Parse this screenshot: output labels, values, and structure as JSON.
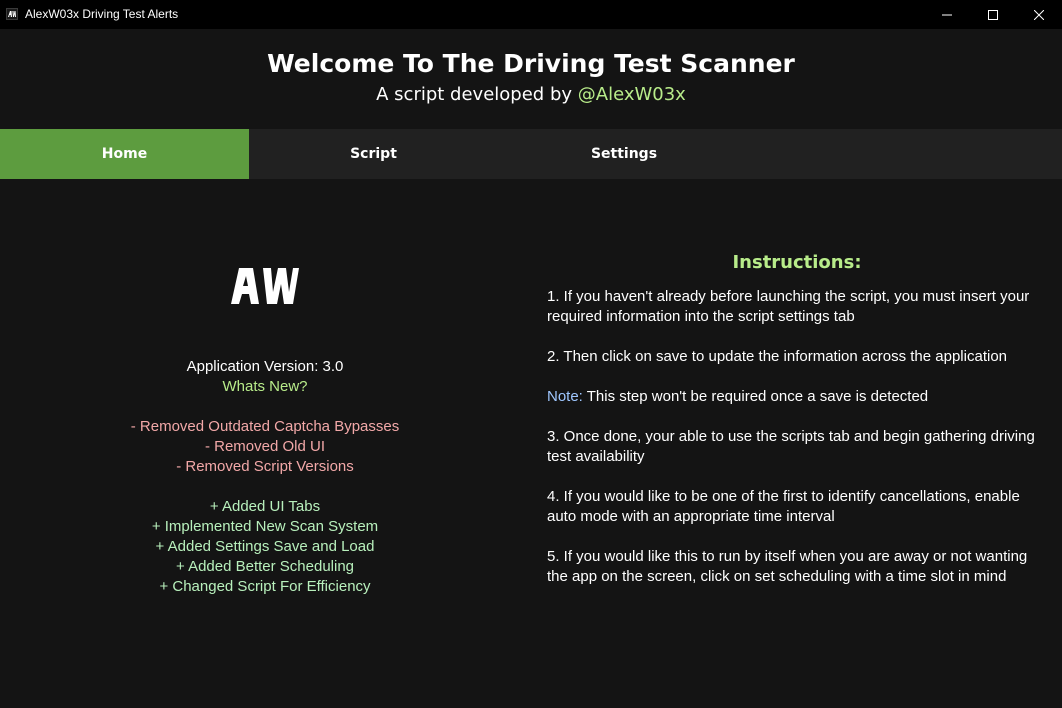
{
  "window": {
    "title": "AlexW03x Driving Test Alerts",
    "icon": "aw-logo-icon"
  },
  "header": {
    "title": "Welcome To The Driving Test Scanner",
    "subtitle_prefix": "A script developed by ",
    "subtitle_handle": "@AlexW03x"
  },
  "tabs": [
    {
      "label": "Home",
      "active": true
    },
    {
      "label": "Script",
      "active": false
    },
    {
      "label": "Settings",
      "active": false
    }
  ],
  "home": {
    "version_text": "Application Version: 3.0",
    "whats_new_label": "Whats New?",
    "removed": [
      "- Removed Outdated Captcha Bypasses",
      "- Removed Old UI",
      "- Removed Script Versions"
    ],
    "added": [
      "+ Added UI Tabs",
      "+ Implemented New Scan System",
      "+ Added Settings Save and Load",
      "+ Added Better Scheduling",
      "+ Changed Script For Efficiency"
    ]
  },
  "instructions": {
    "title": "Instructions:",
    "step1": "1. If you haven't already before launching the script, you must insert your required information into the script settings tab",
    "step2": "2. Then click on save to update the information across the application",
    "note_label": "Note:",
    "note_text": " This step won't be required once a save is detected",
    "step3": "3. Once done, your able to use the scripts tab and begin gathering driving test availability",
    "step4": "4. If you would like to be one of the first to identify cancellations, enable auto mode with an appropriate time interval",
    "step5": "5. If you would like this to run by itself when you are away or not wanting the app on the screen, click on set scheduling with a time slot in mind"
  },
  "colors": {
    "accent_green": "#5d9c3f",
    "light_green": "#b8ec8a",
    "removed_red": "#f2a8a8",
    "added_mint": "#b8f0bc",
    "note_blue": "#9fc7ff"
  }
}
